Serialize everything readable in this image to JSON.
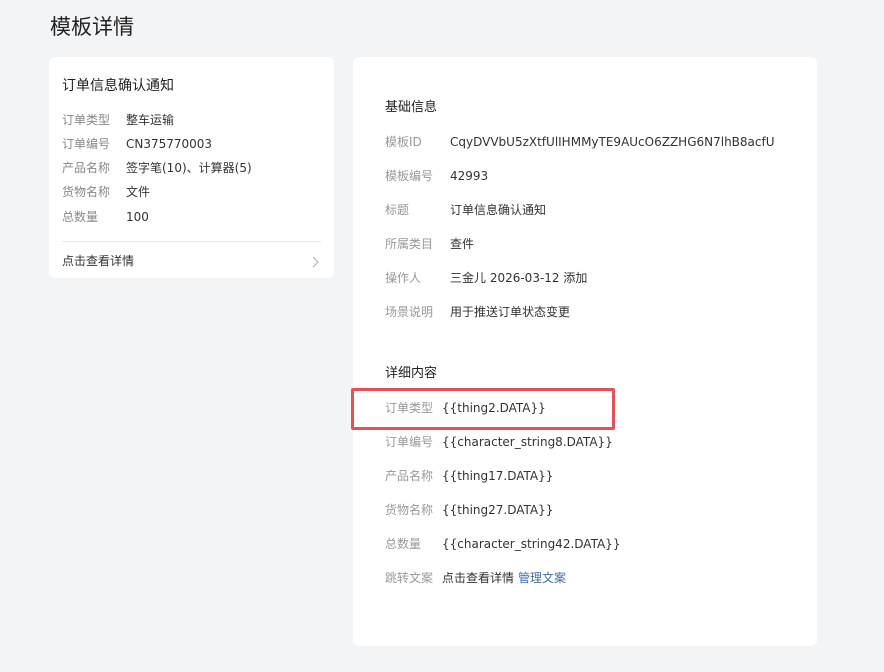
{
  "page": {
    "title": "模板详情"
  },
  "preview": {
    "title": "订单信息确认通知",
    "rows": [
      {
        "key": "订单类型",
        "value": "整车运输"
      },
      {
        "key": "订单编号",
        "value": "CN375770003"
      },
      {
        "key": "产品名称",
        "value": "签字笔(10)、计算器(5)"
      },
      {
        "key": "货物名称",
        "value": "文件"
      },
      {
        "key": "总数量",
        "value": "100"
      }
    ],
    "view_detail_label": "点击查看详情"
  },
  "basic_info": {
    "section_title": "基础信息",
    "rows": [
      {
        "key": "模板ID",
        "value": "CqyDVVbU5zXtfUlIHMMyTE9AUcO6ZZHG6N7lhB8acfU"
      },
      {
        "key": "模板编号",
        "value": "42993"
      },
      {
        "key": "标题",
        "value": "订单信息确认通知"
      },
      {
        "key": "所属类目",
        "value": "查件"
      },
      {
        "key": "操作人",
        "value": "三金儿 2026-03-12 添加"
      },
      {
        "key": "场景说明",
        "value": "用于推送订单状态变更"
      }
    ]
  },
  "detail_content": {
    "section_title": "详细内容",
    "rows": [
      {
        "key": "订单类型",
        "value": "{{thing2.DATA}}"
      },
      {
        "key": "订单编号",
        "value": "{{character_string8.DATA}}"
      },
      {
        "key": "产品名称",
        "value": "{{thing17.DATA}}"
      },
      {
        "key": "货物名称",
        "value": "{{thing27.DATA}}"
      },
      {
        "key": "总数量",
        "value": "{{character_string42.DATA}}"
      }
    ],
    "jump": {
      "key": "跳转文案",
      "value": "点击查看详情",
      "link": "管理文案"
    }
  },
  "colors": {
    "page_background": "#f3f4f6",
    "card_background": "#ffffff",
    "link": "#3f6ea8",
    "highlight": "#e35353"
  },
  "icons": {
    "view_detail": "chevron-right-icon"
  }
}
